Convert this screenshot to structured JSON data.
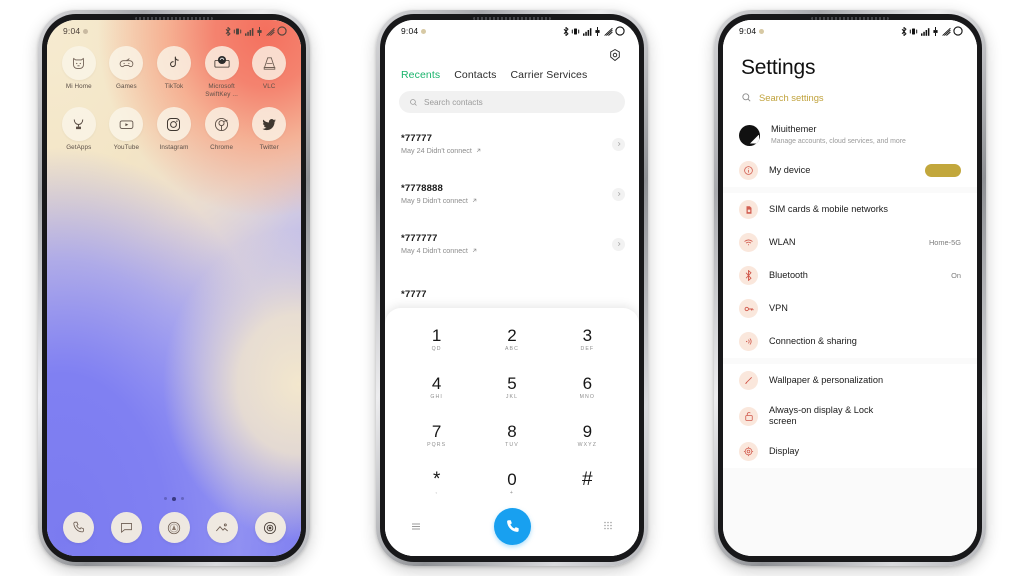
{
  "statusbar": {
    "time": "9:04",
    "icons": [
      "bluetooth-icon",
      "vibrate-icon",
      "signal-icon",
      "data-icon",
      "wifi-icon",
      "battery-icon"
    ]
  },
  "home": {
    "apps_row1": [
      {
        "label": "Mi Home",
        "icon": "mi-home-icon"
      },
      {
        "label": "Games",
        "icon": "games-icon"
      },
      {
        "label": "TikTok",
        "icon": "tiktok-icon"
      },
      {
        "label": "Microsoft SwiftKey ...",
        "icon": "swiftkey-icon"
      },
      {
        "label": "VLC",
        "icon": "vlc-icon"
      }
    ],
    "apps_row2": [
      {
        "label": "GetApps",
        "icon": "getapps-icon"
      },
      {
        "label": "YouTube",
        "icon": "youtube-icon"
      },
      {
        "label": "Instagram",
        "icon": "instagram-icon"
      },
      {
        "label": "Chrome",
        "icon": "chrome-icon"
      },
      {
        "label": "Twitter",
        "icon": "twitter-icon"
      }
    ],
    "dock": [
      "phone-icon",
      "messages-icon",
      "browser-icon",
      "gallery-icon",
      "camera-icon"
    ],
    "page_dots": {
      "count": 3,
      "active": 1
    }
  },
  "dialer": {
    "settings_icon": "gear-icon",
    "tabs": [
      {
        "label": "Recents",
        "active": true
      },
      {
        "label": "Contacts",
        "active": false
      },
      {
        "label": "Carrier Services",
        "active": false
      }
    ],
    "search": {
      "placeholder": "Search contacts",
      "icon": "search-icon"
    },
    "calls": [
      {
        "number": "*77777",
        "detail": "May 24 Didn't connect"
      },
      {
        "number": "*7778888",
        "detail": "May 9 Didn't connect"
      },
      {
        "number": "*777777",
        "detail": "May 4 Didn't connect"
      },
      {
        "number": "*7777",
        "detail": ""
      }
    ],
    "keypad": [
      {
        "digit": "1",
        "sub": "QD"
      },
      {
        "digit": "2",
        "sub": "ABC"
      },
      {
        "digit": "3",
        "sub": "DEF"
      },
      {
        "digit": "4",
        "sub": "GHI"
      },
      {
        "digit": "5",
        "sub": "JKL"
      },
      {
        "digit": "6",
        "sub": "MNO"
      },
      {
        "digit": "7",
        "sub": "PQRS"
      },
      {
        "digit": "8",
        "sub": "TUV"
      },
      {
        "digit": "9",
        "sub": "WXYZ"
      },
      {
        "digit": "*",
        "sub": ","
      },
      {
        "digit": "0",
        "sub": "+"
      },
      {
        "digit": "#",
        "sub": ""
      }
    ],
    "pad_left_icon": "menu-icon",
    "call_button_icon": "call-icon",
    "pad_right_icon": "keypad-icon",
    "accent_green": "#19b36b",
    "call_button_color": "#18a0f0"
  },
  "settings": {
    "title": "Settings",
    "search": {
      "placeholder": "Search settings",
      "icon": "search-icon"
    },
    "account": {
      "name": "Miuithemer",
      "subtitle": "Manage accounts, cloud services, and more",
      "icon": "account-avatar"
    },
    "groups": [
      {
        "items": [
          {
            "label": "My device",
            "value": "",
            "icon": "info-icon",
            "badge": "gold-pill"
          }
        ]
      },
      {
        "items": [
          {
            "label": "SIM cards & mobile networks",
            "value": "",
            "icon": "sim-icon"
          },
          {
            "label": "WLAN",
            "value": "Home-5G",
            "icon": "wifi-icon"
          },
          {
            "label": "Bluetooth",
            "value": "On",
            "icon": "bluetooth-icon"
          },
          {
            "label": "VPN",
            "value": "",
            "icon": "vpn-icon"
          },
          {
            "label": "Connection & sharing",
            "value": "",
            "icon": "share-icon"
          }
        ]
      },
      {
        "items": [
          {
            "label": "Wallpaper & personalization",
            "value": "",
            "icon": "brush-icon"
          },
          {
            "label": "Always-on display & Lock screen",
            "value": "",
            "icon": "lock-icon"
          },
          {
            "label": "Display",
            "value": "",
            "icon": "display-icon"
          }
        ]
      }
    ],
    "accent_gold": "#c2a73c",
    "icon_bg": "#fae7dc"
  }
}
